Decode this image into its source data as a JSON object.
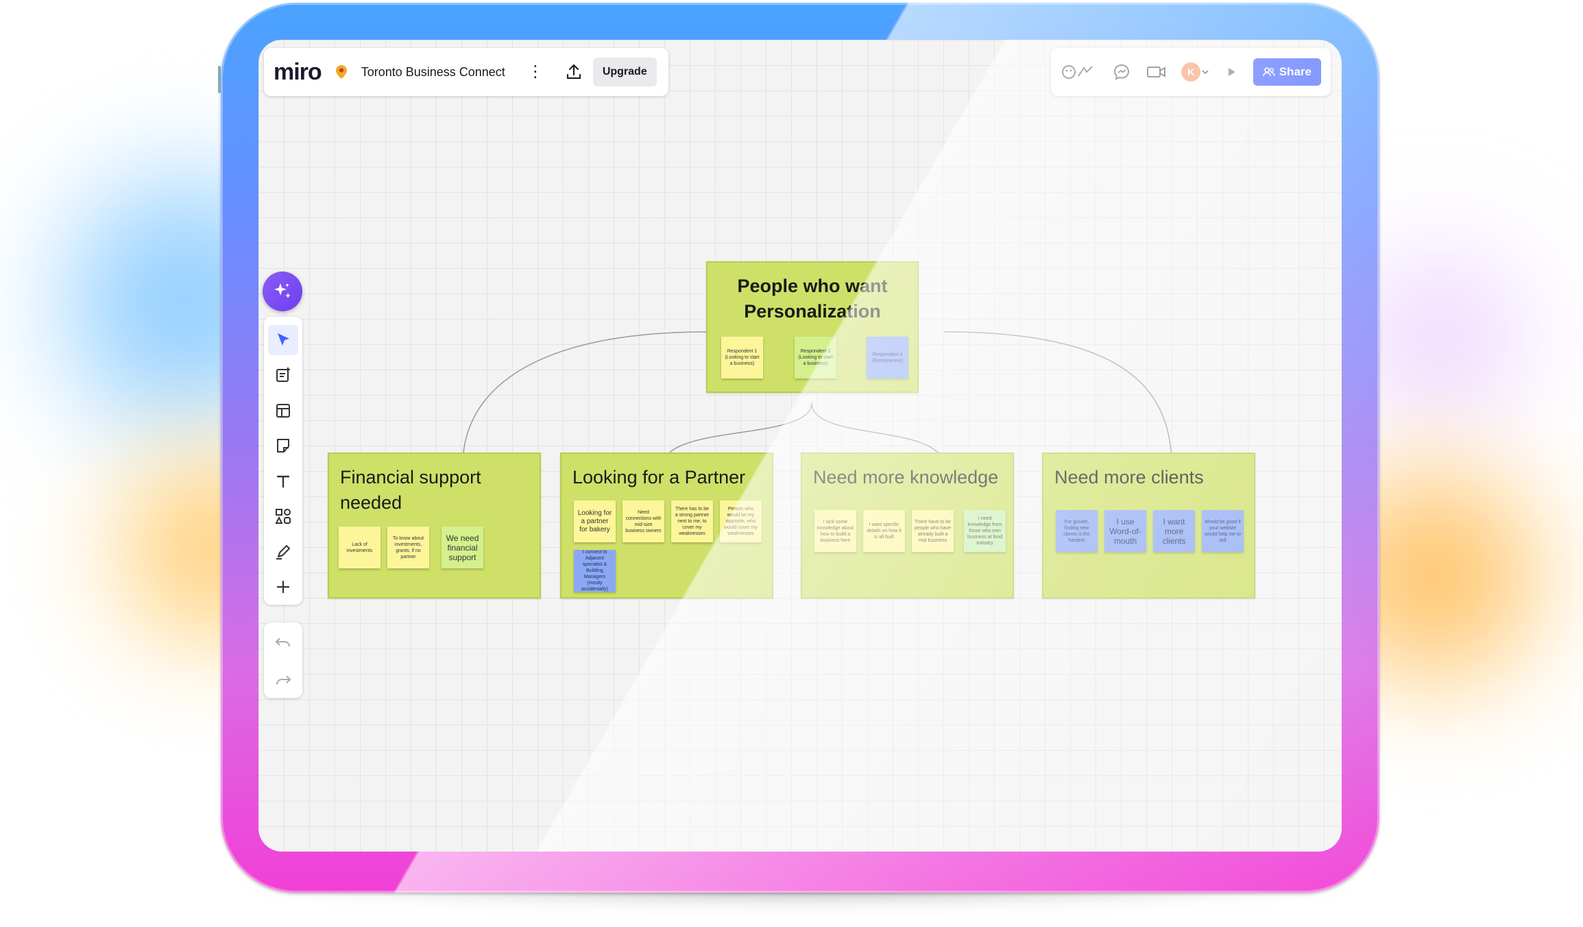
{
  "app": {
    "logo": "miro",
    "board_name": "Toronto Business Connect",
    "upgrade_label": "Upgrade",
    "share_label": "Share",
    "avatar_initial": "K"
  },
  "colors": {
    "accent": "#4262ff",
    "ai": "#7c4dff",
    "frame": "#cee067",
    "sticky_yellow": "#fdf59a",
    "sticky_green": "#d4f08c",
    "sticky_blue": "#8ba8f4"
  },
  "toolbar": {
    "icons": [
      "cursor-icon",
      "template-icon",
      "table-icon",
      "sticky-note-icon",
      "text-icon",
      "shapes-icon",
      "pen-icon",
      "plus-icon"
    ]
  },
  "root": {
    "title_line1": "People who want",
    "title_line2": "Personalization",
    "notes": [
      "Respondent 1 (Looking to start a business)",
      "Respondent 2 (Looking to start a business)",
      "Respondent 3 (Entrepreneur)"
    ]
  },
  "groups": [
    {
      "title": "Financial support needed",
      "notes": [
        "Lack of investments",
        "To know about investments, grants, if no partner",
        "We need financial support"
      ]
    },
    {
      "title": "Looking for a Partner",
      "notes": [
        "Looking for a partner for bakery",
        "Need connections with mid-size business owners",
        "There has to be a strong partner next to me, to cover my weaknesses",
        "Person who would be my opposite, who would cover my weaknesses",
        "I connect to Adjacent specialist & Building Managers (mostly accidentally)"
      ]
    },
    {
      "title": "Need more knowledge",
      "notes": [
        "I lack some knowledge about how to build a business here",
        "I want specific details on how it is all built",
        "There have to be people who have already built a real business",
        "I need knowledge from those who own business at food industry"
      ]
    },
    {
      "title": "Need more clients",
      "notes": [
        "For growth, finding new clients is the hardest",
        "I use Word-of-mouth",
        "I want more clients",
        "Would be good if your website would help me to sell"
      ]
    }
  ]
}
